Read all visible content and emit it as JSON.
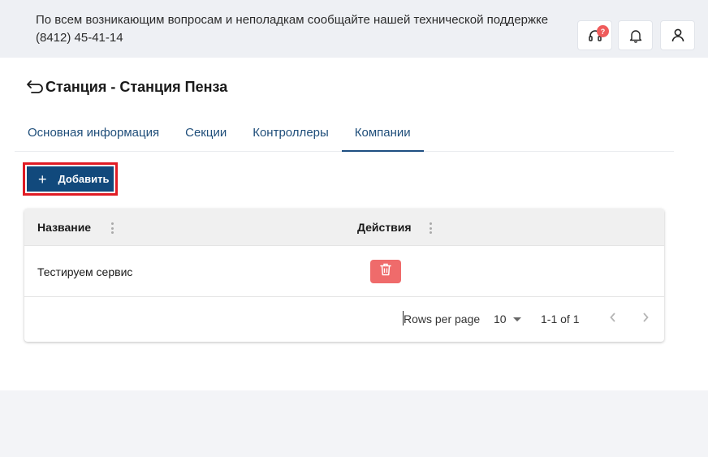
{
  "topbar": {
    "notice_line1": "По всем возникающим вопросам и неполадкам сообщайте нашей технической поддержке",
    "notice_line2": "(8412) 45-41-14",
    "support_badge": "?",
    "icons": [
      "headset-icon",
      "bell-icon",
      "user-icon"
    ]
  },
  "page": {
    "title": "Станция - Станция Пенза"
  },
  "tabs": [
    {
      "label": "Основная информация",
      "active": false
    },
    {
      "label": "Секции",
      "active": false
    },
    {
      "label": "Контроллеры",
      "active": false
    },
    {
      "label": "Компании",
      "active": true
    }
  ],
  "add_button": {
    "label": "Добавить",
    "icon": "plus-icon",
    "color": "#11497c",
    "highlight_color": "#e01b24"
  },
  "table": {
    "columns": [
      "Название",
      "Действия"
    ],
    "rows": [
      {
        "name": "Тестируем сервис",
        "action": "trash-icon"
      }
    ],
    "footer": {
      "rows_per_page_label": "Rows per page",
      "rows_per_page_value": "10",
      "range": "1-1 of 1"
    }
  },
  "colors": {
    "accent": "#1e4f82",
    "delete": "#ef6b6b",
    "topbar_bg": "#eef0f4"
  }
}
